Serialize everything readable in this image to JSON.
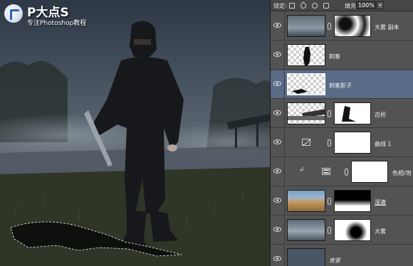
{
  "watermark": {
    "title": "P大点S",
    "subtitle": "专注Photoshop教程"
  },
  "toolbar": {
    "lock_label": "锁定:",
    "fill_label": "填充:",
    "fill_value": "100%",
    "icons": [
      "transparency-lock-icon",
      "brush-icon",
      "move-icon",
      "padlock-icon"
    ]
  },
  "layers": [
    {
      "name": "大雾 副本",
      "has_mask": true,
      "selected": false
    },
    {
      "name": "刺客",
      "has_mask": false,
      "selected": false
    },
    {
      "name": "刺客影子",
      "has_mask": false,
      "selected": true
    },
    {
      "name": "古桥",
      "has_mask": true,
      "selected": false
    },
    {
      "name": "曲线 1",
      "has_mask": true,
      "selected": false,
      "adjustment": "curves-icon"
    },
    {
      "name": "色相/饱",
      "has_mask": true,
      "selected": false,
      "adjustment": "hue-saturation-icon"
    },
    {
      "name": "湿漉",
      "has_mask": true,
      "selected": false
    },
    {
      "name": "大雾",
      "has_mask": true,
      "selected": false
    },
    {
      "name": "背景",
      "has_mask": false,
      "selected": false
    }
  ],
  "colors": {
    "selected_layer": "#5a6b87",
    "panel_bg": "#535353"
  }
}
